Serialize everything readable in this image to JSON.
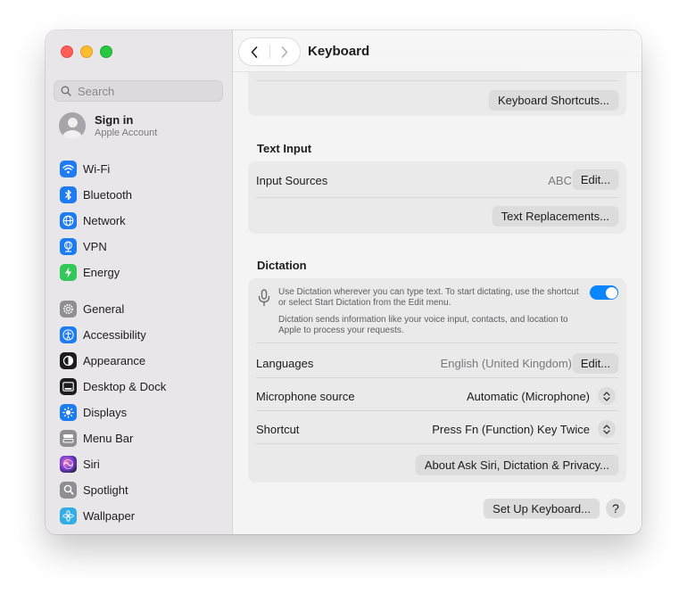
{
  "window": {
    "title": "Keyboard"
  },
  "search": {
    "placeholder": "Search"
  },
  "account": {
    "name": "Sign in",
    "subtitle": "Apple Account"
  },
  "sidebar": {
    "items": [
      {
        "label": "Wi-Fi",
        "icon": "wifi-icon",
        "color": "#1e7cf2"
      },
      {
        "label": "Bluetooth",
        "icon": "bluetooth-icon",
        "color": "#1e7cf2"
      },
      {
        "label": "Network",
        "icon": "globe-icon",
        "color": "#1e7cf2"
      },
      {
        "label": "VPN",
        "icon": "vpn-icon",
        "color": "#1e7cf2"
      },
      {
        "label": "Energy",
        "icon": "bolt-icon",
        "color": "#34c759"
      },
      {
        "label": "General",
        "icon": "gear-icon",
        "color": "#8e8e93"
      },
      {
        "label": "Accessibility",
        "icon": "accessibility-icon",
        "color": "#1e7cf2"
      },
      {
        "label": "Appearance",
        "icon": "appearance-icon",
        "color": "#1d1d1f"
      },
      {
        "label": "Desktop & Dock",
        "icon": "dock-icon",
        "color": "#1d1d1f"
      },
      {
        "label": "Displays",
        "icon": "sun-icon",
        "color": "#1e7cf2"
      },
      {
        "label": "Menu Bar",
        "icon": "menu-bar-icon",
        "color": "#8e8e93"
      },
      {
        "label": "Siri",
        "icon": "siri-icon",
        "color": "#7a3de0"
      },
      {
        "label": "Spotlight",
        "icon": "magnifier-icon",
        "color": "#8e8e93"
      },
      {
        "label": "Wallpaper",
        "icon": "flower-icon",
        "color": "#32ade6"
      }
    ]
  },
  "main": {
    "top_card": {
      "shortcuts_button": "Keyboard Shortcuts..."
    },
    "text_input": {
      "heading": "Text Input",
      "input_sources_label": "Input Sources",
      "input_sources_value": "ABC",
      "edit_button": "Edit...",
      "text_replacements_button": "Text Replacements..."
    },
    "dictation": {
      "heading": "Dictation",
      "description_line1": "Use Dictation wherever you can type text. To start dictating, use the shortcut",
      "description_line2": "or select Start Dictation from the Edit menu.",
      "privacy_line1": "Dictation sends information like your voice input, contacts, and location to",
      "privacy_line2": "Apple to process your requests.",
      "enabled": true,
      "languages_label": "Languages",
      "languages_value": "English (United Kingdom)",
      "languages_edit_button": "Edit...",
      "microphone_label": "Microphone source",
      "microphone_value": "Automatic (Microphone)",
      "shortcut_label": "Shortcut",
      "shortcut_value": "Press Fn (Function) Key Twice",
      "about_button": "About Ask Siri, Dictation & Privacy..."
    },
    "footer": {
      "setup_button": "Set Up Keyboard...",
      "help_label": "?"
    }
  }
}
